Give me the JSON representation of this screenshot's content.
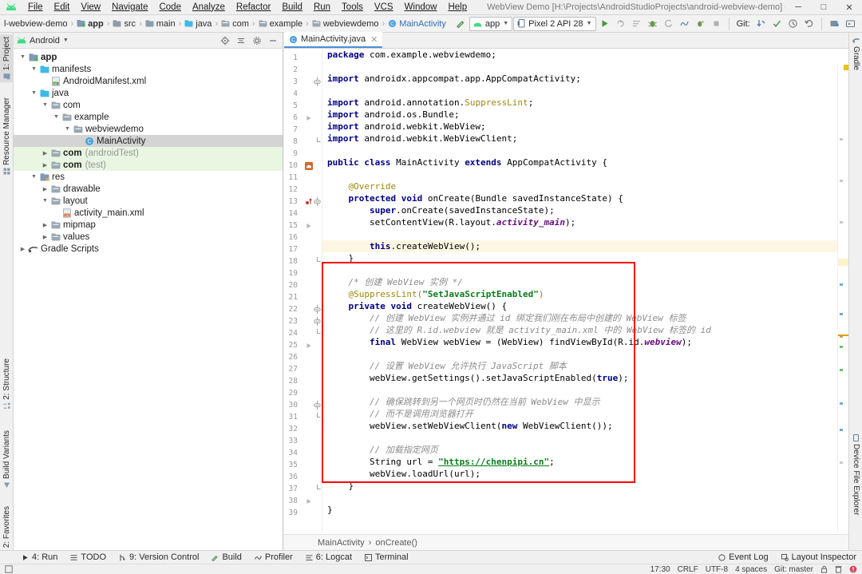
{
  "window": {
    "title": "WebView Demo [H:\\Projects\\AndroidStudioProjects\\android-webview-demo] - ...\\webviewdemo\\MainActivity.java [app]",
    "minimize": "─",
    "maximize": "□",
    "close": "✕"
  },
  "menu": [
    "File",
    "Edit",
    "View",
    "Navigate",
    "Code",
    "Analyze",
    "Refactor",
    "Build",
    "Run",
    "Tools",
    "VCS",
    "Window",
    "Help"
  ],
  "breadcrumbs": [
    {
      "label": "l-webview-demo",
      "icon": "none",
      "bold": false,
      "link": false
    },
    {
      "label": "app",
      "icon": "module",
      "bold": true,
      "link": false
    },
    {
      "label": "src",
      "icon": "folder",
      "bold": false,
      "link": false
    },
    {
      "label": "main",
      "icon": "folder",
      "bold": false,
      "link": false
    },
    {
      "label": "java",
      "icon": "folder-src",
      "bold": false,
      "link": false
    },
    {
      "label": "com",
      "icon": "package",
      "bold": false,
      "link": false
    },
    {
      "label": "example",
      "icon": "package",
      "bold": false,
      "link": false
    },
    {
      "label": "webviewdemo",
      "icon": "package",
      "bold": false,
      "link": false
    },
    {
      "label": "MainActivity",
      "icon": "class",
      "bold": false,
      "link": true
    }
  ],
  "toolbar": {
    "run_config": "app",
    "device": "Pixel 2 API 28",
    "git_label": "Git:",
    "icons": [
      "build-hammer-icon",
      "run-icon",
      "apply-changes-icon",
      "apply-code-changes-icon",
      "debug-icon",
      "attach-debugger-icon",
      "profiler-icon",
      "run-with-coverage-icon",
      "stop-icon",
      "update-project-icon",
      "commit-icon",
      "history-icon",
      "rollback-icon",
      "sdk-manager-icon",
      "avd-manager-icon",
      "layout-inspector-icon",
      "device-file-explorer-icon",
      "sync-gradle-icon",
      "search-everywhere-icon",
      "profiler-avatar-icon"
    ]
  },
  "left_strip": {
    "top": [
      {
        "label": "1: Project",
        "icon": "project-icon",
        "selected": true
      }
    ],
    "top2": [
      {
        "label": "Resource Manager",
        "icon": "resource-manager-icon",
        "selected": false
      }
    ],
    "bottom": [
      {
        "label": "2: Structure",
        "icon": "structure-icon"
      },
      {
        "label": "Build Variants",
        "icon": "build-variants-icon"
      },
      {
        "label": "2: Favorites",
        "icon": "favorites-icon"
      }
    ]
  },
  "right_strip": {
    "top": [
      {
        "label": "Gradle",
        "icon": "gradle-icon"
      }
    ],
    "bottom": [
      {
        "label": "Device File Explorer",
        "icon": "device-file-explorer-icon"
      }
    ]
  },
  "project_panel": {
    "view_selector": "Android",
    "header_icons": [
      "locate-icon",
      "collapse-all-icon",
      "settings-gear-icon",
      "hide-icon"
    ],
    "tree": [
      {
        "depth": 0,
        "label": "app",
        "arrow": "down",
        "icon": "module-icon",
        "bold": true,
        "state": "normal"
      },
      {
        "depth": 1,
        "label": "manifests",
        "arrow": "down",
        "icon": "folder-icon",
        "bold": false,
        "state": "normal"
      },
      {
        "depth": 2,
        "label": "AndroidManifest.xml",
        "arrow": "none",
        "icon": "manifest-file-icon",
        "bold": false,
        "state": "normal"
      },
      {
        "depth": 1,
        "label": "java",
        "arrow": "down",
        "icon": "folder-src-icon",
        "bold": false,
        "state": "normal"
      },
      {
        "depth": 2,
        "label": "com",
        "arrow": "down",
        "icon": "package-icon",
        "bold": false,
        "state": "normal"
      },
      {
        "depth": 3,
        "label": "example",
        "arrow": "down",
        "icon": "package-icon",
        "bold": false,
        "state": "normal"
      },
      {
        "depth": 4,
        "label": "webviewdemo",
        "arrow": "down",
        "icon": "package-icon",
        "bold": false,
        "state": "normal"
      },
      {
        "depth": 5,
        "label": "MainActivity",
        "arrow": "none",
        "icon": "class-icon",
        "bold": false,
        "state": "selected",
        "link": true
      },
      {
        "depth": 2,
        "label": "com",
        "suffix": "(androidTest)",
        "arrow": "right",
        "icon": "package-icon",
        "bold": true,
        "state": "green"
      },
      {
        "depth": 2,
        "label": "com",
        "suffix": "(test)",
        "arrow": "right",
        "icon": "package-icon",
        "bold": true,
        "state": "green"
      },
      {
        "depth": 1,
        "label": "res",
        "arrow": "down",
        "icon": "res-folder-icon",
        "bold": false,
        "state": "normal"
      },
      {
        "depth": 2,
        "label": "drawable",
        "arrow": "right",
        "icon": "package-icon",
        "bold": false,
        "state": "normal"
      },
      {
        "depth": 2,
        "label": "layout",
        "arrow": "down",
        "icon": "package-icon",
        "bold": false,
        "state": "normal"
      },
      {
        "depth": 3,
        "label": "activity_main.xml",
        "arrow": "none",
        "icon": "layout-file-icon",
        "bold": false,
        "state": "normal"
      },
      {
        "depth": 2,
        "label": "mipmap",
        "arrow": "right",
        "icon": "package-icon",
        "bold": false,
        "state": "normal"
      },
      {
        "depth": 2,
        "label": "values",
        "arrow": "right",
        "icon": "package-icon",
        "bold": false,
        "state": "normal"
      },
      {
        "depth": 0,
        "label": "Gradle Scripts",
        "arrow": "right",
        "icon": "gradle-icon",
        "bold": false,
        "state": "normal"
      }
    ]
  },
  "editor": {
    "tab": {
      "label": "MainActivity.java",
      "icon": "class-icon",
      "close": "✕"
    },
    "breadcrumb": [
      "MainActivity",
      "onCreate()"
    ],
    "breadcrumb_sep": "›",
    "highlight_line": 17,
    "annotation_box": {
      "color": "#ff0000",
      "from_line": 20,
      "to_line": 37
    },
    "lines": [
      {
        "n": 1,
        "tokens": [
          {
            "t": "package ",
            "c": "kw"
          },
          {
            "t": "com.example.webviewdemo;",
            "c": "pl"
          }
        ]
      },
      {
        "n": 2,
        "tokens": []
      },
      {
        "n": 3,
        "tokens": [
          {
            "t": "import ",
            "c": "kw"
          },
          {
            "t": "androidx.appcompat.app.AppCompatActivity;",
            "c": "pl"
          }
        ],
        "fold": "start"
      },
      {
        "n": 4,
        "tokens": []
      },
      {
        "n": 5,
        "tokens": [
          {
            "t": "import ",
            "c": "kw"
          },
          {
            "t": "android.annotation.",
            "c": "pl"
          },
          {
            "t": "SuppressLint",
            "c": "ann"
          },
          {
            "t": ";",
            "c": "pl"
          }
        ]
      },
      {
        "n": 6,
        "tokens": [
          {
            "t": "import ",
            "c": "kw"
          },
          {
            "t": "android.os.Bundle;",
            "c": "pl"
          }
        ],
        "gutter": "run-gray"
      },
      {
        "n": 7,
        "tokens": [
          {
            "t": "import ",
            "c": "kw"
          },
          {
            "t": "android.webkit.WebView;",
            "c": "pl"
          }
        ]
      },
      {
        "n": 8,
        "tokens": [
          {
            "t": "import ",
            "c": "kw"
          },
          {
            "t": "android.webkit.WebViewClient;",
            "c": "pl"
          }
        ],
        "fold": "end"
      },
      {
        "n": 9,
        "tokens": []
      },
      {
        "n": 10,
        "tokens": [
          {
            "t": "public class ",
            "c": "kw"
          },
          {
            "t": "MainActivity ",
            "c": "pl"
          },
          {
            "t": "extends ",
            "c": "kw"
          },
          {
            "t": "AppCompatActivity {",
            "c": "pl"
          }
        ],
        "gutter": "android-run"
      },
      {
        "n": 11,
        "tokens": []
      },
      {
        "n": 12,
        "tokens": [
          {
            "t": "    @Override",
            "c": "ann"
          }
        ]
      },
      {
        "n": 13,
        "tokens": [
          {
            "t": "    protected void ",
            "c": "kw"
          },
          {
            "t": "onCreate(Bundle savedInstanceState) {",
            "c": "pl"
          }
        ],
        "gutter": "override",
        "fold": "start"
      },
      {
        "n": 14,
        "tokens": [
          {
            "t": "        super",
            "c": "kw"
          },
          {
            "t": ".onCreate(savedInstanceState);",
            "c": "pl"
          }
        ]
      },
      {
        "n": 15,
        "tokens": [
          {
            "t": "        setContentView(R.layout.",
            "c": "pl"
          },
          {
            "t": "activity_main",
            "c": "fld"
          },
          {
            "t": ");",
            "c": "pl"
          }
        ],
        "gutter": "run-gray"
      },
      {
        "n": 16,
        "tokens": []
      },
      {
        "n": 17,
        "tokens": [
          {
            "t": "        this",
            "c": "kw"
          },
          {
            "t": ".createWebView();",
            "c": "pl"
          }
        ]
      },
      {
        "n": 18,
        "tokens": [
          {
            "t": "    }",
            "c": "pl"
          }
        ],
        "fold": "end"
      },
      {
        "n": 19,
        "tokens": []
      },
      {
        "n": 20,
        "tokens": [
          {
            "t": "    /* 创建 WebView 实例 */",
            "c": "cmt"
          }
        ]
      },
      {
        "n": 21,
        "tokens": [
          {
            "t": "    @SuppressLint(",
            "c": "ann"
          },
          {
            "t": "\"SetJavaScriptEnabled\"",
            "c": "str"
          },
          {
            "t": ")",
            "c": "ann"
          }
        ]
      },
      {
        "n": 22,
        "tokens": [
          {
            "t": "    private void ",
            "c": "kw"
          },
          {
            "t": "createWebView() {",
            "c": "pl"
          }
        ],
        "fold": "start"
      },
      {
        "n": 23,
        "tokens": [
          {
            "t": "        // 创建 WebView 实例并通过 id 绑定我们刚在布局中创建的 WebView 标签",
            "c": "cmt"
          }
        ],
        "fold": "start"
      },
      {
        "n": 24,
        "tokens": [
          {
            "t": "        // 这里的 R.id.webview 就是 activity_main.xml 中的 WebView 标签的 id",
            "c": "cmt"
          }
        ],
        "fold": "end"
      },
      {
        "n": 25,
        "tokens": [
          {
            "t": "        final ",
            "c": "kw"
          },
          {
            "t": "WebView webView = (WebView) findViewById(R.id.",
            "c": "pl"
          },
          {
            "t": "webview",
            "c": "fld"
          },
          {
            "t": ");",
            "c": "pl"
          }
        ],
        "gutter": "run-gray"
      },
      {
        "n": 26,
        "tokens": []
      },
      {
        "n": 27,
        "tokens": [
          {
            "t": "        // 设置 WebView 允许执行 JavaScript 脚本",
            "c": "cmt"
          }
        ]
      },
      {
        "n": 28,
        "tokens": [
          {
            "t": "        webView.getSettings().setJavaScriptEnabled(",
            "c": "pl"
          },
          {
            "t": "true",
            "c": "kw"
          },
          {
            "t": ");",
            "c": "pl"
          }
        ]
      },
      {
        "n": 29,
        "tokens": []
      },
      {
        "n": 30,
        "tokens": [
          {
            "t": "        // 确保跳转到另一个网页时仍然在当前 WebView 中显示",
            "c": "cmt"
          }
        ],
        "fold": "start"
      },
      {
        "n": 31,
        "tokens": [
          {
            "t": "        // 而不是调用浏览器打开",
            "c": "cmt"
          }
        ],
        "fold": "end"
      },
      {
        "n": 32,
        "tokens": [
          {
            "t": "        webView.setWebViewClient(",
            "c": "pl"
          },
          {
            "t": "new ",
            "c": "kw"
          },
          {
            "t": "WebViewClient());",
            "c": "pl"
          }
        ]
      },
      {
        "n": 33,
        "tokens": []
      },
      {
        "n": 34,
        "tokens": [
          {
            "t": "        // 加载指定网页",
            "c": "cmt"
          }
        ]
      },
      {
        "n": 35,
        "tokens": [
          {
            "t": "        String url = ",
            "c": "pl"
          },
          {
            "t": "\"https://chenpipi.cn\"",
            "c": "strlink"
          },
          {
            "t": ";",
            "c": "pl"
          }
        ]
      },
      {
        "n": 36,
        "tokens": [
          {
            "t": "        webView.loadUrl(url);",
            "c": "pl"
          }
        ]
      },
      {
        "n": 37,
        "tokens": [
          {
            "t": "    }",
            "c": "pl"
          }
        ],
        "fold": "end"
      },
      {
        "n": 38,
        "tokens": [],
        "gutter": "run-gray"
      },
      {
        "n": 39,
        "tokens": [
          {
            "t": "}",
            "c": "pl"
          }
        ]
      }
    ]
  },
  "bottom_tabs": [
    {
      "label": "4: Run",
      "icon": "run-icon"
    },
    {
      "label": "TODO",
      "icon": "todo-icon"
    },
    {
      "label": "9: Version Control",
      "icon": "vcs-icon"
    },
    {
      "label": "Build",
      "icon": "build-hammer-icon"
    },
    {
      "label": "Profiler",
      "icon": "profiler-icon"
    },
    {
      "label": "6: Logcat",
      "icon": "logcat-icon"
    },
    {
      "label": "Terminal",
      "icon": "terminal-icon"
    }
  ],
  "bottom_right_tabs": [
    {
      "label": "Event Log",
      "icon": "event-log-icon"
    },
    {
      "label": "Layout Inspector",
      "icon": "layout-inspector-icon"
    }
  ],
  "statusbar": {
    "left_icon": "toggle-toolbar-icon",
    "time": "17:30",
    "line_sep": "CRLF",
    "encoding": "UTF-8",
    "indent": "4 spaces",
    "git_branch": "Git: master",
    "lock_icon": "read-only-lock-icon",
    "trash_icon": "memory-trash-icon",
    "error_icon": "error-badge-icon"
  },
  "colors": {
    "accent": "#4a90d9",
    "link": "#2f6fb5",
    "keyword": "#000080",
    "string": "#067d17",
    "comment": "#8c8c8c",
    "annotation": "#9e880d",
    "field": "#660e7a",
    "box": "#ff0000",
    "selection": "#d4d4d4",
    "test_source": "#e8f6e2",
    "caret_row": "#fdf6e3"
  }
}
